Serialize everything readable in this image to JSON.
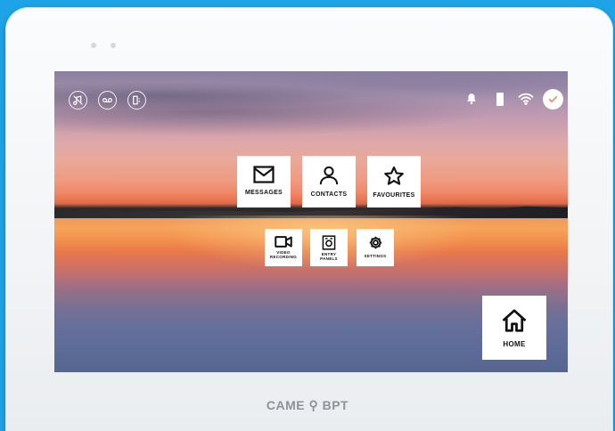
{
  "device": {
    "brand": "CAME ⚲ BPT"
  },
  "status_bar": {
    "left_icons": [
      "audio-mute-icon",
      "voicemail-icon",
      "door-lock-icon"
    ],
    "right_icons": [
      "bell-icon",
      "door-icon",
      "wifi-icon",
      "check-circle-icon"
    ]
  },
  "main_tiles": [
    {
      "label": "MESSAGES",
      "icon": "envelope-icon"
    },
    {
      "label": "CONTACTS",
      "icon": "person-icon"
    },
    {
      "label": "FAVOURITES",
      "icon": "star-icon"
    }
  ],
  "small_tiles": [
    {
      "label_1": "VIDEO",
      "label_2": "RECORDING",
      "icon": "video-camera-icon"
    },
    {
      "label_1": "ENTRY",
      "label_2": "PANELS",
      "icon": "entry-panel-icon"
    },
    {
      "label_1": "SETTINGS",
      "icon": "gear-icon"
    }
  ],
  "home": {
    "label": "HOME",
    "icon": "home-icon"
  },
  "colors": {
    "frame_background": "#1ea3e6",
    "tile": "#ffffff"
  }
}
